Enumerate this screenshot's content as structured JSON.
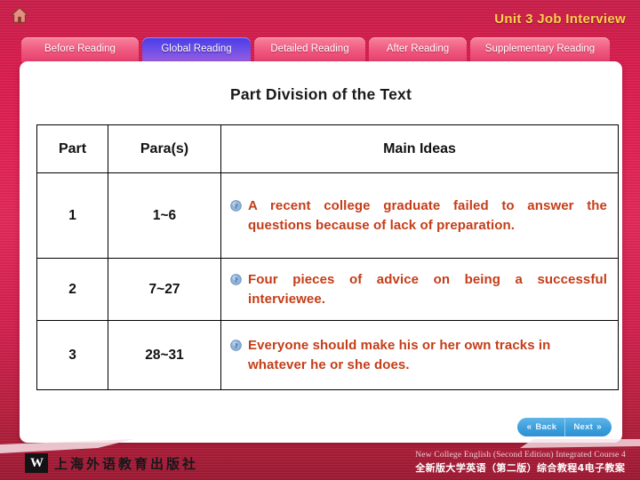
{
  "header": {
    "home_icon": "home-icon",
    "unit_title": "Unit 3  Job Interview"
  },
  "tabs": [
    {
      "label": "Before Reading",
      "active": false
    },
    {
      "label": "Global Reading",
      "active": true
    },
    {
      "label": "Detailed Reading",
      "active": false
    },
    {
      "label": "After Reading",
      "active": false
    },
    {
      "label": "Supplementary Reading",
      "active": false
    }
  ],
  "slide": {
    "title": "Part Division of the Text"
  },
  "table": {
    "headers": [
      "Part",
      "Para(s)",
      "Main Ideas"
    ],
    "rows": [
      {
        "part": "1",
        "paras": "1~6",
        "idea": "A recent college graduate failed to answer the questions because of lack of preparation.",
        "bullet_icon": "question-mark-icon"
      },
      {
        "part": "2",
        "paras": "7~27",
        "idea": "Four pieces of advice on being a successful interviewee.",
        "bullet_icon": "question-mark-icon"
      },
      {
        "part": "3",
        "paras": "28~31",
        "idea": "Everyone should make his or her own tracks in whatever he or she does.",
        "bullet_icon": "question-mark-icon"
      }
    ]
  },
  "nav": {
    "back_label": "Back",
    "next_label": "Next",
    "back_icon": "double-chevron-left-icon",
    "next_icon": "double-chevron-right-icon"
  },
  "footer": {
    "publisher_logo": "W",
    "publisher_name": "上海外语教育出版社",
    "course_en": "New College English (Second Edition) Integrated Course 4",
    "course_cn": "全新版大学英语（第二版）综合教程4电子教案"
  },
  "colors": {
    "background_red": "#d81e4e",
    "tab_pink": "#ef5a80",
    "tab_active_blue": "#6a4ce8",
    "unit_title_gold": "#ffd24d",
    "idea_text_orange": "#c43d18",
    "nav_button_blue": "#3c9fdd",
    "panel_white": "#ffffff"
  }
}
